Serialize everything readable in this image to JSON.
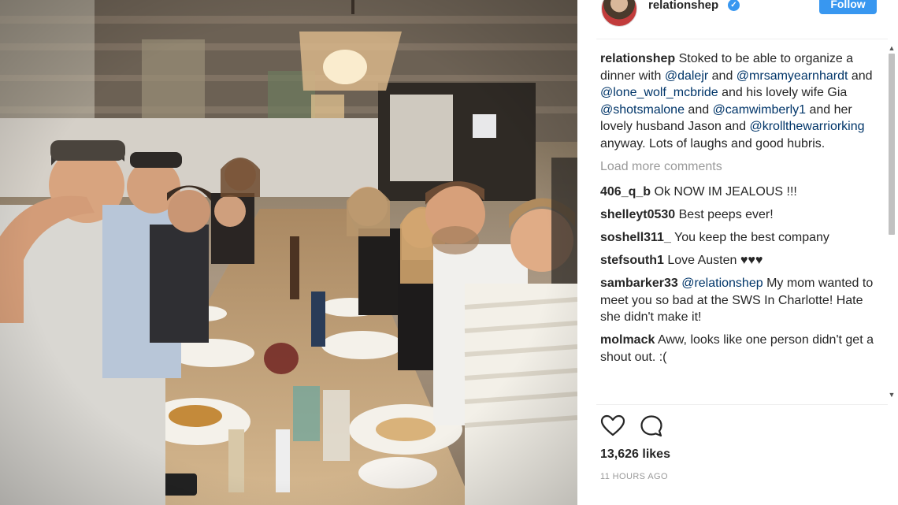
{
  "post": {
    "username": "relationshep",
    "follow_label": "Follow",
    "verified_badge": "✓"
  },
  "caption": {
    "user": "relationshep",
    "parts": [
      {
        "t": "text",
        "v": " Stoked to be able to organize a dinner with "
      },
      {
        "t": "mention",
        "v": "@dalejr"
      },
      {
        "t": "text",
        "v": " and "
      },
      {
        "t": "mention",
        "v": "@mrsamyearnhardt"
      },
      {
        "t": "text",
        "v": " and "
      },
      {
        "t": "mention",
        "v": "@lone_wolf_mcbride"
      },
      {
        "t": "text",
        "v": " and his lovely wife Gia "
      },
      {
        "t": "mention",
        "v": "@shotsmalone"
      },
      {
        "t": "text",
        "v": " and "
      },
      {
        "t": "mention",
        "v": "@camwimberly1"
      },
      {
        "t": "text",
        "v": " and her lovely husband Jason and "
      },
      {
        "t": "mention",
        "v": "@krollthewarriorking"
      },
      {
        "t": "text",
        "v": " anyway. Lots of laughs and good hubris."
      }
    ]
  },
  "load_more_label": "Load more comments",
  "comments": [
    {
      "user": "406_q_b",
      "parts": [
        {
          "t": "text",
          "v": " Ok NOW IM JEALOUS !!!"
        }
      ]
    },
    {
      "user": "shelleyt0530",
      "parts": [
        {
          "t": "text",
          "v": " Best peeps ever!"
        }
      ]
    },
    {
      "user": "soshell311_",
      "parts": [
        {
          "t": "text",
          "v": " You keep the best company"
        }
      ]
    },
    {
      "user": "stefsouth1",
      "parts": [
        {
          "t": "text",
          "v": " Love Austen ♥♥♥"
        }
      ]
    },
    {
      "user": "sambarker33",
      "parts": [
        {
          "t": "text",
          "v": " "
        },
        {
          "t": "mention",
          "v": "@relationshep"
        },
        {
          "t": "text",
          "v": " My mom wanted to meet you so bad at the SWS In Charlotte! Hate she didn't make it!"
        }
      ]
    },
    {
      "user": "molmack",
      "parts": [
        {
          "t": "text",
          "v": " Aww, looks like one person didn't get a shout out. :("
        }
      ]
    }
  ],
  "likes_label": "13,626 likes",
  "time_label": "11 HOURS AGO",
  "icons": {
    "like": "heart-icon",
    "comment": "comment-bubble-icon",
    "verified": "verified-badge-icon"
  },
  "colors": {
    "accent": "#3897f0",
    "mention": "#003569",
    "muted": "#999999",
    "text": "#262626"
  }
}
